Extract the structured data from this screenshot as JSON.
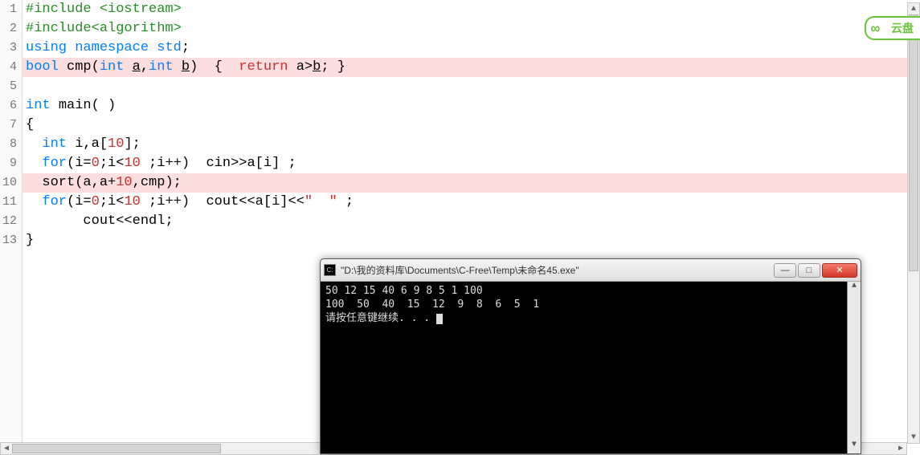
{
  "editor": {
    "lines": [
      {
        "n": 1,
        "hl": false
      },
      {
        "n": 2,
        "hl": false
      },
      {
        "n": 3,
        "hl": false
      },
      {
        "n": 4,
        "hl": true
      },
      {
        "n": 5,
        "hl": false
      },
      {
        "n": 6,
        "hl": false
      },
      {
        "n": 7,
        "hl": false
      },
      {
        "n": 8,
        "hl": false
      },
      {
        "n": 9,
        "hl": false
      },
      {
        "n": 10,
        "hl": true
      },
      {
        "n": 11,
        "hl": false
      },
      {
        "n": 12,
        "hl": false
      },
      {
        "n": 13,
        "hl": false
      }
    ],
    "src": {
      "l1": "#include <iostream>",
      "l2": "#include<algorithm>",
      "l3_using": "using",
      "l3_namespace": "namespace",
      "l3_std": "std",
      "l4_bool": "bool",
      "l4_cmp": "cmp",
      "l4_int1": "int",
      "l4_a": "a",
      "l4_int2": "int",
      "l4_b": "b",
      "l4_return": "return",
      "l4_expr_a": "a",
      "l4_expr_b": "b",
      "l6_int": "int",
      "l6_main": "main",
      "l8_int": "int",
      "l8_i": "i",
      "l8_a": "a",
      "l8_10": "10",
      "l9_for": "for",
      "l9_0": "0",
      "l9_10": "10",
      "l9_cin": "cin",
      "l10_sort": "sort",
      "l10_10": "10",
      "l10_cmp": "cmp",
      "l11_for": "for",
      "l11_0": "0",
      "l11_10": "10",
      "l11_cout": "cout",
      "l11_spaces": "\"  \"",
      "l12_cout": "cout",
      "l12_endl": "endl"
    }
  },
  "cloud_badge": {
    "text": "云盘"
  },
  "top_stub_label": "▾",
  "console": {
    "title": "\"D:\\我的资料库\\Documents\\C-Free\\Temp\\未命名45.exe\"",
    "lines": [
      "50 12 15 40 6 9 8 5 1 100",
      "100  50  40  15  12  9  8  6  5  1",
      "请按任意键继续. . . "
    ],
    "buttons": {
      "minimize": "—",
      "maximize": "□",
      "close": "✕"
    }
  }
}
